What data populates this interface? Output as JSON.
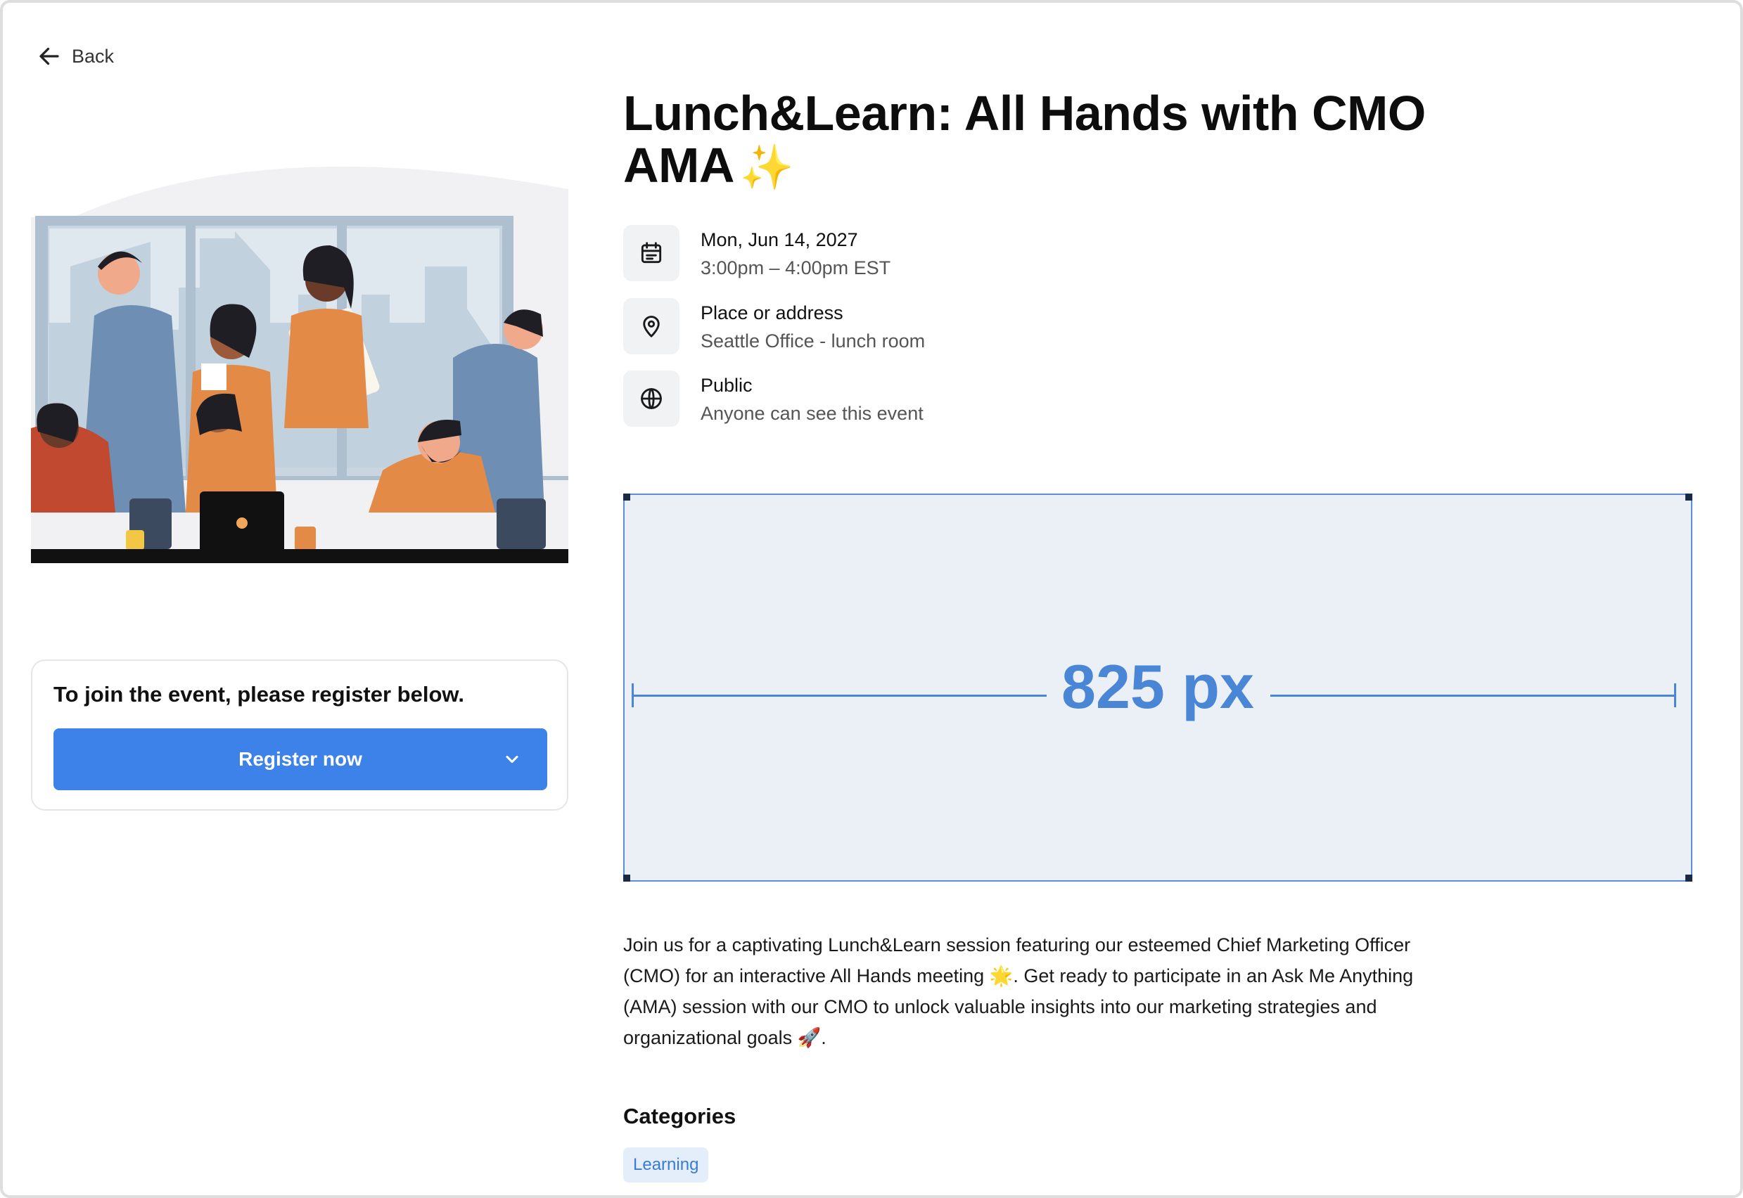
{
  "nav": {
    "back_label": "Back"
  },
  "event": {
    "title": "Lunch&Learn: All Hands with CMO AMA",
    "title_emoji": "✨",
    "date": "Mon, Jun 14, 2027",
    "time": "3:00pm – 4:00pm EST",
    "location_label": "Place or address",
    "location_value": "Seattle Office - lunch room",
    "visibility_label": "Public",
    "visibility_value": "Anyone can see this event",
    "description": "Join us for a captivating Lunch&Learn session featuring our esteemed Chief Marketing Officer (CMO) for an interactive All Hands meeting 🌟. Get ready to participate in an Ask Me Anything (AMA) session with our CMO to unlock valuable insights into our marketing strategies and organizational goals 🚀."
  },
  "register": {
    "note": "To join the event, please register below.",
    "button_label": "Register now"
  },
  "placeholder": {
    "label": "825 px"
  },
  "categories": {
    "heading": "Categories",
    "items": [
      "Learning"
    ]
  },
  "icons": {
    "back": "arrow-left-icon",
    "date": "calendar-icon",
    "location": "map-pin-icon",
    "visibility": "globe-icon",
    "dropdown": "chevron-down-icon"
  },
  "colors": {
    "accent": "#3d82e8",
    "chip_bg": "#e4eefb",
    "chip_text": "#3a7bd5",
    "placeholder_bg": "#ebf0f7"
  }
}
